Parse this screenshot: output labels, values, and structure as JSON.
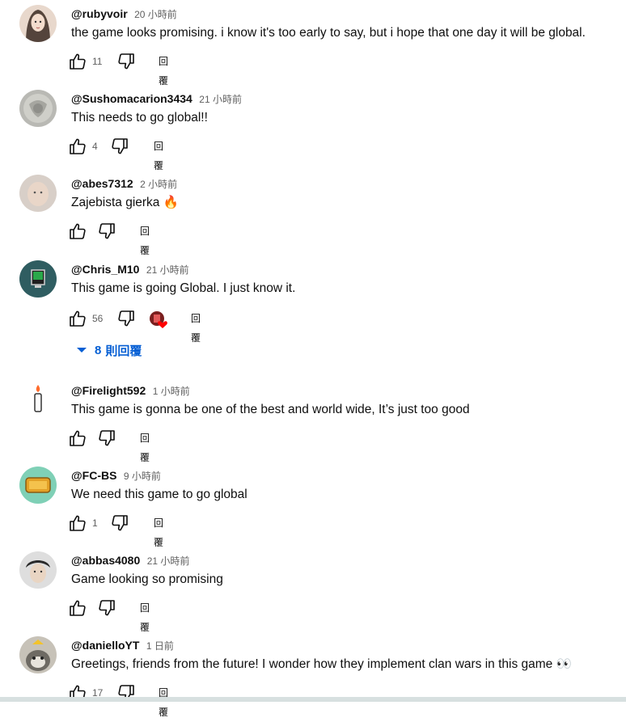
{
  "ui": {
    "reply_label": "回覆",
    "accent_color": "#065fd4"
  },
  "comments": [
    {
      "author": "@rubyvoir",
      "time": "20 小時前",
      "text": "the game looks promising. i know it's too early to say, but i hope that one day it will be global.",
      "likes": "11"
    },
    {
      "author": "@Sushomacarion3434",
      "time": "21 小時前",
      "text": "This needs to go global!!",
      "likes": "4"
    },
    {
      "author": "@abes7312",
      "time": "2 小時前",
      "text": "Zajebista gierka 🔥",
      "likes": ""
    },
    {
      "author": "@Chris_M10",
      "time": "21 小時前",
      "text": "This game is going Global. I just know it.",
      "likes": "56",
      "creator_heart": true
    },
    {
      "author": "@Firelight592",
      "time": "1 小時前",
      "text": "This game is gonna be one of the best and world wide, It’s just too good",
      "likes": ""
    },
    {
      "author": "@FC-BS",
      "time": "9 小時前",
      "text": "We need this game to go global",
      "likes": "1"
    },
    {
      "author": "@abbas4080",
      "time": "21 小時前",
      "text": "Game looking so promising",
      "likes": ""
    },
    {
      "author": "@danielloYT",
      "time": "1 日前",
      "text": "Greetings, friends from the future! I wonder how they implement clan wars in this game 👀",
      "likes": "17"
    }
  ],
  "replies_toggle": {
    "count": "8",
    "label": "則回覆"
  }
}
